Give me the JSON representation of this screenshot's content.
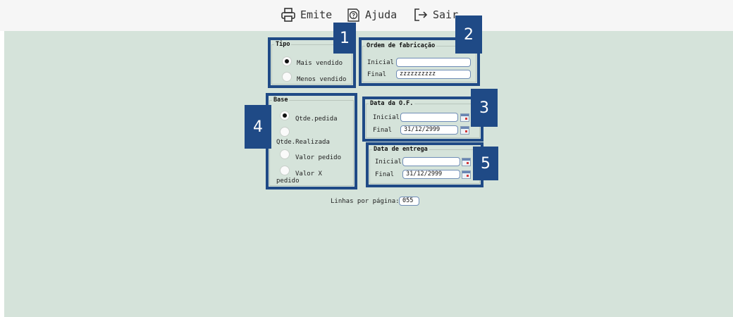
{
  "toolbar": {
    "emite": "Emite",
    "ajuda": "Ajuda",
    "sair": "Sair"
  },
  "badges": [
    "1",
    "2",
    "3",
    "4",
    "5"
  ],
  "tipo": {
    "title": "Tipo",
    "options": [
      "Mais vendido",
      "Menos vendido"
    ],
    "selected": "Mais vendido"
  },
  "ordem": {
    "title": "Ordem de fabricação",
    "inicial_label": "Inicial",
    "final_label": "Final",
    "inicial_value": "",
    "final_value": "zzzzzzzzzz"
  },
  "base": {
    "title": "Base",
    "options": [
      "Qtde.pedida",
      "Qtde.Realizada",
      "Valor pedido",
      "Valor X pedido"
    ],
    "selected": "Qtde.pedida"
  },
  "data_of": {
    "title": "Data da O.F.",
    "inicial_label": "Inicial",
    "final_label": "Final",
    "inicial_value": "",
    "final_value": "31/12/2999"
  },
  "data_entrega": {
    "title": "Data de entrega",
    "inicial_label": "Inicial",
    "final_label": "Final",
    "inicial_value": "",
    "final_value": "31/12/2999"
  },
  "linhas": {
    "label": "Linhas por página:",
    "value": "055"
  },
  "colors": {
    "highlight": "#1f4a86",
    "background": "#d5e3da",
    "toolbar": "#f6f6f6"
  }
}
